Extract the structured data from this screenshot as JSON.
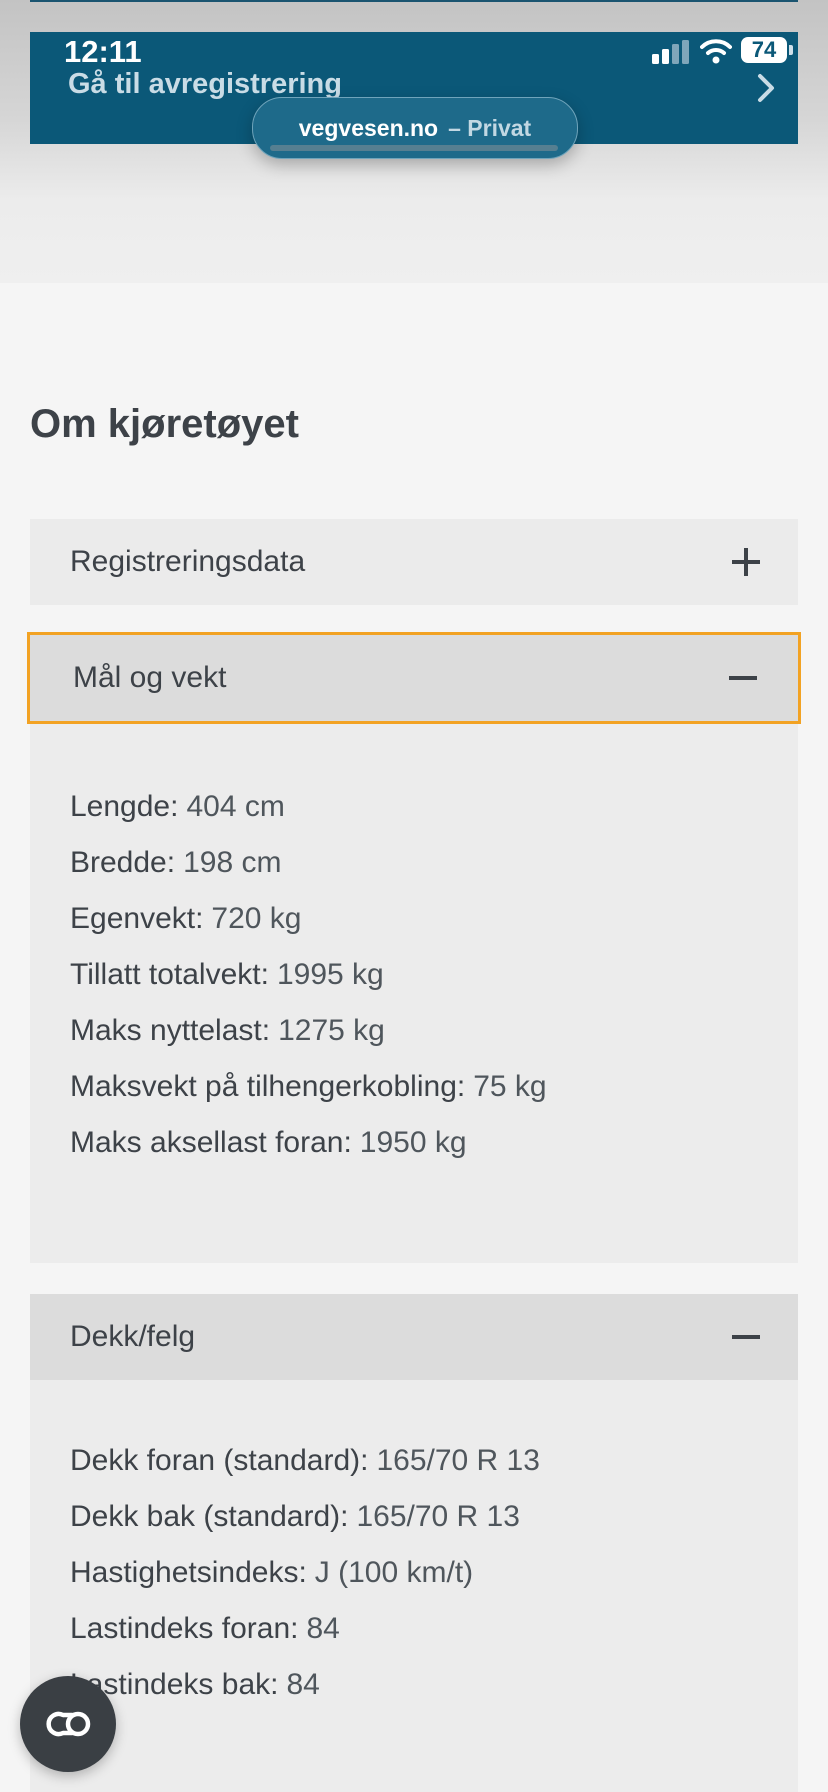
{
  "status_bar": {
    "time": "12:11",
    "battery": "74"
  },
  "banner": {
    "link_text": "Gå til avregistrering"
  },
  "browser": {
    "host": "vegvesen.no",
    "mode": "– Privat"
  },
  "section": {
    "title": "Om kjøretøyet"
  },
  "accordions": [
    {
      "title": "Registreringsdata",
      "expanded": false
    },
    {
      "title": "Mål og vekt",
      "expanded": true,
      "items": [
        {
          "label": "Lengde:",
          "value": "404 cm"
        },
        {
          "label": "Bredde:",
          "value": "198 cm"
        },
        {
          "label": "Egenvekt:",
          "value": "720 kg"
        },
        {
          "label": "Tillatt totalvekt:",
          "value": "1995 kg"
        },
        {
          "label": "Maks nyttelast:",
          "value": "1275 kg"
        },
        {
          "label": "Maksvekt på tilhengerkobling:",
          "value": "75 kg"
        },
        {
          "label": "Maks aksellast foran:",
          "value": "1950 kg"
        }
      ]
    },
    {
      "title": "Dekk/felg",
      "expanded": true,
      "items": [
        {
          "label": "Dekk foran (standard):",
          "value": "165/70 R 13"
        },
        {
          "label": "Dekk bak (standard):",
          "value": "165/70 R 13"
        },
        {
          "label": "Hastighetsindeks:",
          "value": "J (100 km/t)"
        },
        {
          "label": "Lastindeks foran:",
          "value": "84"
        },
        {
          "label": "Lastindeks bak:",
          "value": "84"
        }
      ]
    }
  ],
  "colors": {
    "banner": "#0b5878",
    "focus_outline": "#f2a223",
    "text": "#3d4248"
  }
}
